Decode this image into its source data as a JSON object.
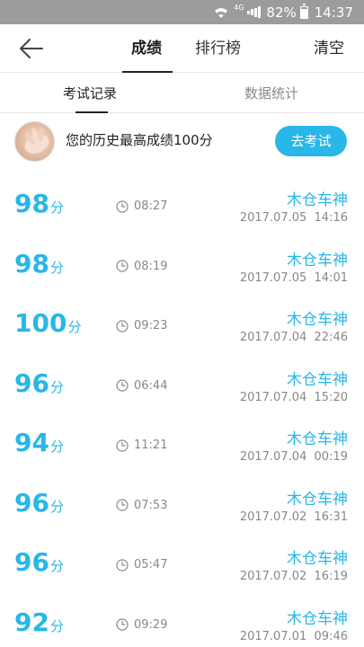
{
  "status_bar": {
    "network": "4G",
    "battery": "82%",
    "time": "14:37"
  },
  "nav": {
    "back_icon": "arrow-left-icon",
    "tabs": [
      "成绩",
      "排行榜"
    ],
    "clear": "清空"
  },
  "sub_tabs": [
    "考试记录",
    "数据统计"
  ],
  "best": {
    "text": "您的历史最高成绩100分",
    "button": "去考试"
  },
  "records": [
    {
      "score": "98",
      "unit": "分",
      "duration": "08:27",
      "subject": "木仓车神",
      "datetime": "2017.07.05  14:16"
    },
    {
      "score": "98",
      "unit": "分",
      "duration": "08:19",
      "subject": "木仓车神",
      "datetime": "2017.07.05  14:01"
    },
    {
      "score": "100",
      "unit": "分",
      "duration": "09:23",
      "subject": "木仓车神",
      "datetime": "2017.07.04  22:46"
    },
    {
      "score": "96",
      "unit": "分",
      "duration": "06:44",
      "subject": "木仓车神",
      "datetime": "2017.07.04  15:20"
    },
    {
      "score": "94",
      "unit": "分",
      "duration": "11:21",
      "subject": "木仓车神",
      "datetime": "2017.07.04  00:19"
    },
    {
      "score": "96",
      "unit": "分",
      "duration": "07:53",
      "subject": "木仓车神",
      "datetime": "2017.07.02  16:31"
    },
    {
      "score": "96",
      "unit": "分",
      "duration": "05:47",
      "subject": "木仓车神",
      "datetime": "2017.07.02  16:19"
    },
    {
      "score": "92",
      "unit": "分",
      "duration": "09:29",
      "subject": "木仓车神",
      "datetime": "2017.07.01  09:46"
    }
  ],
  "colors": {
    "accent": "#29b6e8",
    "status_bar": "#9c9c9c"
  }
}
